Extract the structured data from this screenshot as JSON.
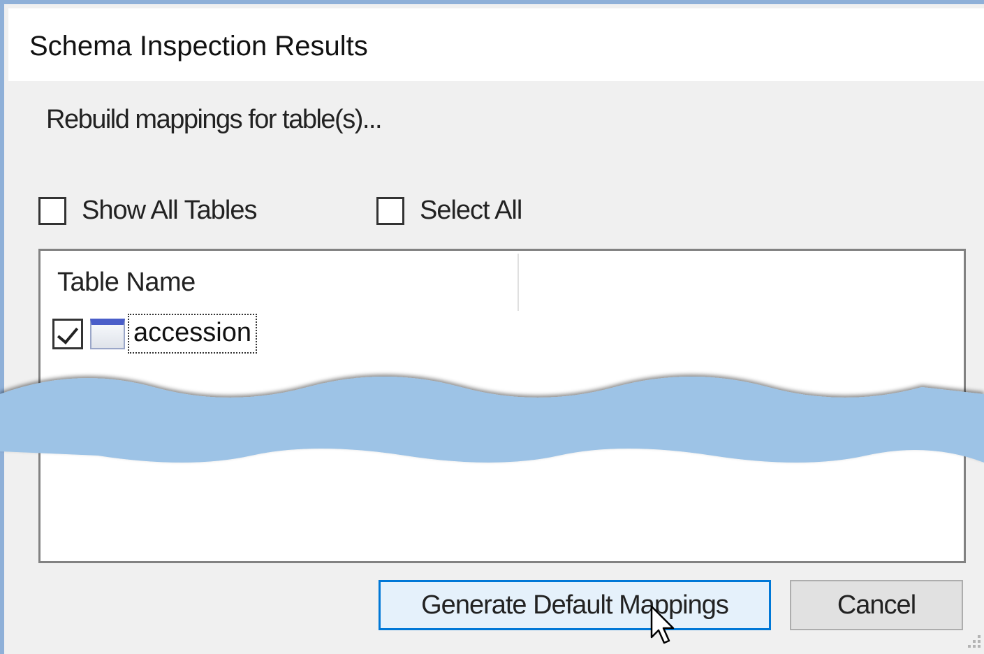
{
  "dialog": {
    "title": "Schema Inspection Results",
    "instruction": "Rebuild mappings for table(s)..."
  },
  "options": {
    "show_all_tables": {
      "label": "Show All Tables",
      "checked": false
    },
    "select_all": {
      "label": "Select All",
      "checked": false
    }
  },
  "table_list": {
    "columns": [
      "Table Name",
      ""
    ],
    "rows": [
      {
        "checked": true,
        "icon": "table-icon",
        "name": "accession",
        "focused": true
      }
    ]
  },
  "buttons": {
    "generate_label": "Generate Default Mappings",
    "cancel_label": "Cancel"
  },
  "colors": {
    "accent_border": "#0078d7",
    "primary_button_bg": "#e5f1fb",
    "window_border": "#8fb0d8",
    "wave_fill": "#9dc3e6"
  }
}
